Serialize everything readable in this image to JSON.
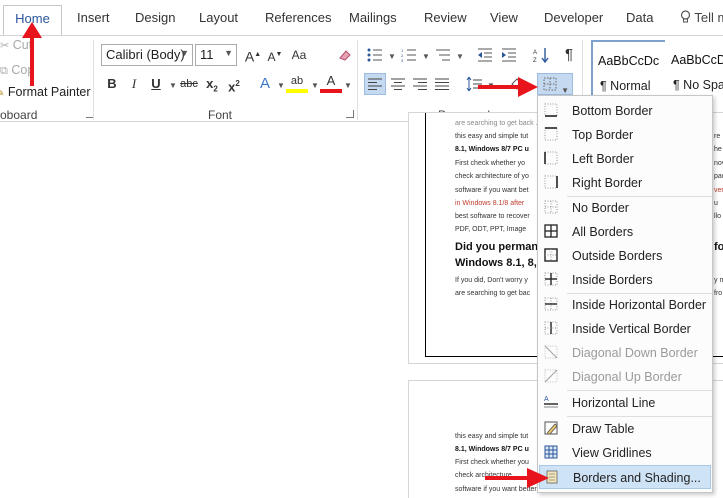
{
  "tabs": {
    "home": "Home",
    "insert": "Insert",
    "design": "Design",
    "layout": "Layout",
    "references": "References",
    "mailings": "Mailings",
    "review": "Review",
    "view": "View",
    "developer": "Developer",
    "data": "Data",
    "tell": "Tell m"
  },
  "clipboard": {
    "cut": "Cut",
    "copy": "Cop",
    "format_painter": "Format Painter",
    "group_label": "oboard"
  },
  "font": {
    "name": "Calibri (Body)",
    "size": "11",
    "group_label": "Font",
    "bold": "B",
    "italic": "I",
    "underline": "U",
    "strikethrough": "abc",
    "subscript": "x",
    "superscript": "x",
    "subscript_mark": "2",
    "superscript_mark": "2",
    "grow": "A",
    "shrink": "A",
    "aa": "Aa",
    "effects": "A",
    "highlight": "ab",
    "color": "A"
  },
  "paragraph": {
    "group_label": "Paragraph",
    "pilcrow": "¶"
  },
  "styles": [
    {
      "preview": "AaBbCcDc",
      "name": "¶ Normal"
    },
    {
      "preview": "AaBbCcD",
      "name": "¶ No Spac..."
    }
  ],
  "document": {
    "lines_page1": [
      "are searching to get back ...",
      "this easy and simple tut",
      "8.1, Windows 8/7 PC u",
      "First check whether yo",
      "check architecture of yo",
      "software if you want bet",
      "in Windows 8.1/8  after",
      "best software to recover",
      "PDF, ODT, PPT, Image"
    ],
    "heading1": "Did you perman",
    "heading2": "Windows 8.1, 8,",
    "lines_after": [
      "If you did, Don't worry y",
      "are searching to get bac"
    ],
    "lines_page2": [
      "this easy and simple tut",
      "8.1, Windows 8/7 PC u",
      "First check whether you",
      "check architecture",
      "software if you want better performance. There are many software's to recover"
    ],
    "edge_chars": [
      "re",
      "he",
      "nov",
      "pad",
      "ver",
      "u",
      "llo",
      "fo",
      "y m",
      "fro"
    ]
  },
  "borders_menu": {
    "items": [
      {
        "label": "Bottom Border",
        "icon": "bottom-border-icon",
        "disabled": false
      },
      {
        "label": "Top Border",
        "icon": "top-border-icon",
        "disabled": false
      },
      {
        "label": "Left Border",
        "icon": "left-border-icon",
        "disabled": false
      },
      {
        "label": "Right Border",
        "icon": "right-border-icon",
        "disabled": false
      },
      {
        "label": "No Border",
        "icon": "no-border-icon",
        "disabled": false
      },
      {
        "label": "All Borders",
        "icon": "all-borders-icon",
        "disabled": false
      },
      {
        "label": "Outside Borders",
        "icon": "outside-borders-icon",
        "disabled": false
      },
      {
        "label": "Inside Borders",
        "icon": "inside-borders-icon",
        "disabled": false
      },
      {
        "label": "Inside Horizontal Border",
        "icon": "inside-horizontal-border-icon",
        "disabled": false
      },
      {
        "label": "Inside Vertical Border",
        "icon": "inside-vertical-border-icon",
        "disabled": false
      },
      {
        "label": "Diagonal Down Border",
        "icon": "diagonal-down-border-icon",
        "disabled": true
      },
      {
        "label": "Diagonal Up Border",
        "icon": "diagonal-up-border-icon",
        "disabled": true
      },
      {
        "label": "Horizontal Line",
        "icon": "horizontal-line-icon",
        "disabled": false
      },
      {
        "label": "Draw Table",
        "icon": "draw-table-icon",
        "disabled": false
      },
      {
        "label": "View Gridlines",
        "icon": "view-gridlines-icon",
        "disabled": false
      },
      {
        "label": "Borders and Shading...",
        "icon": "borders-shading-icon",
        "disabled": false,
        "highlighted": true
      }
    ]
  },
  "colors": {
    "accent": "#2b579a",
    "annotation": "#e8141c",
    "menu_highlight": "#cfe3f7",
    "link": "#c0392b"
  }
}
